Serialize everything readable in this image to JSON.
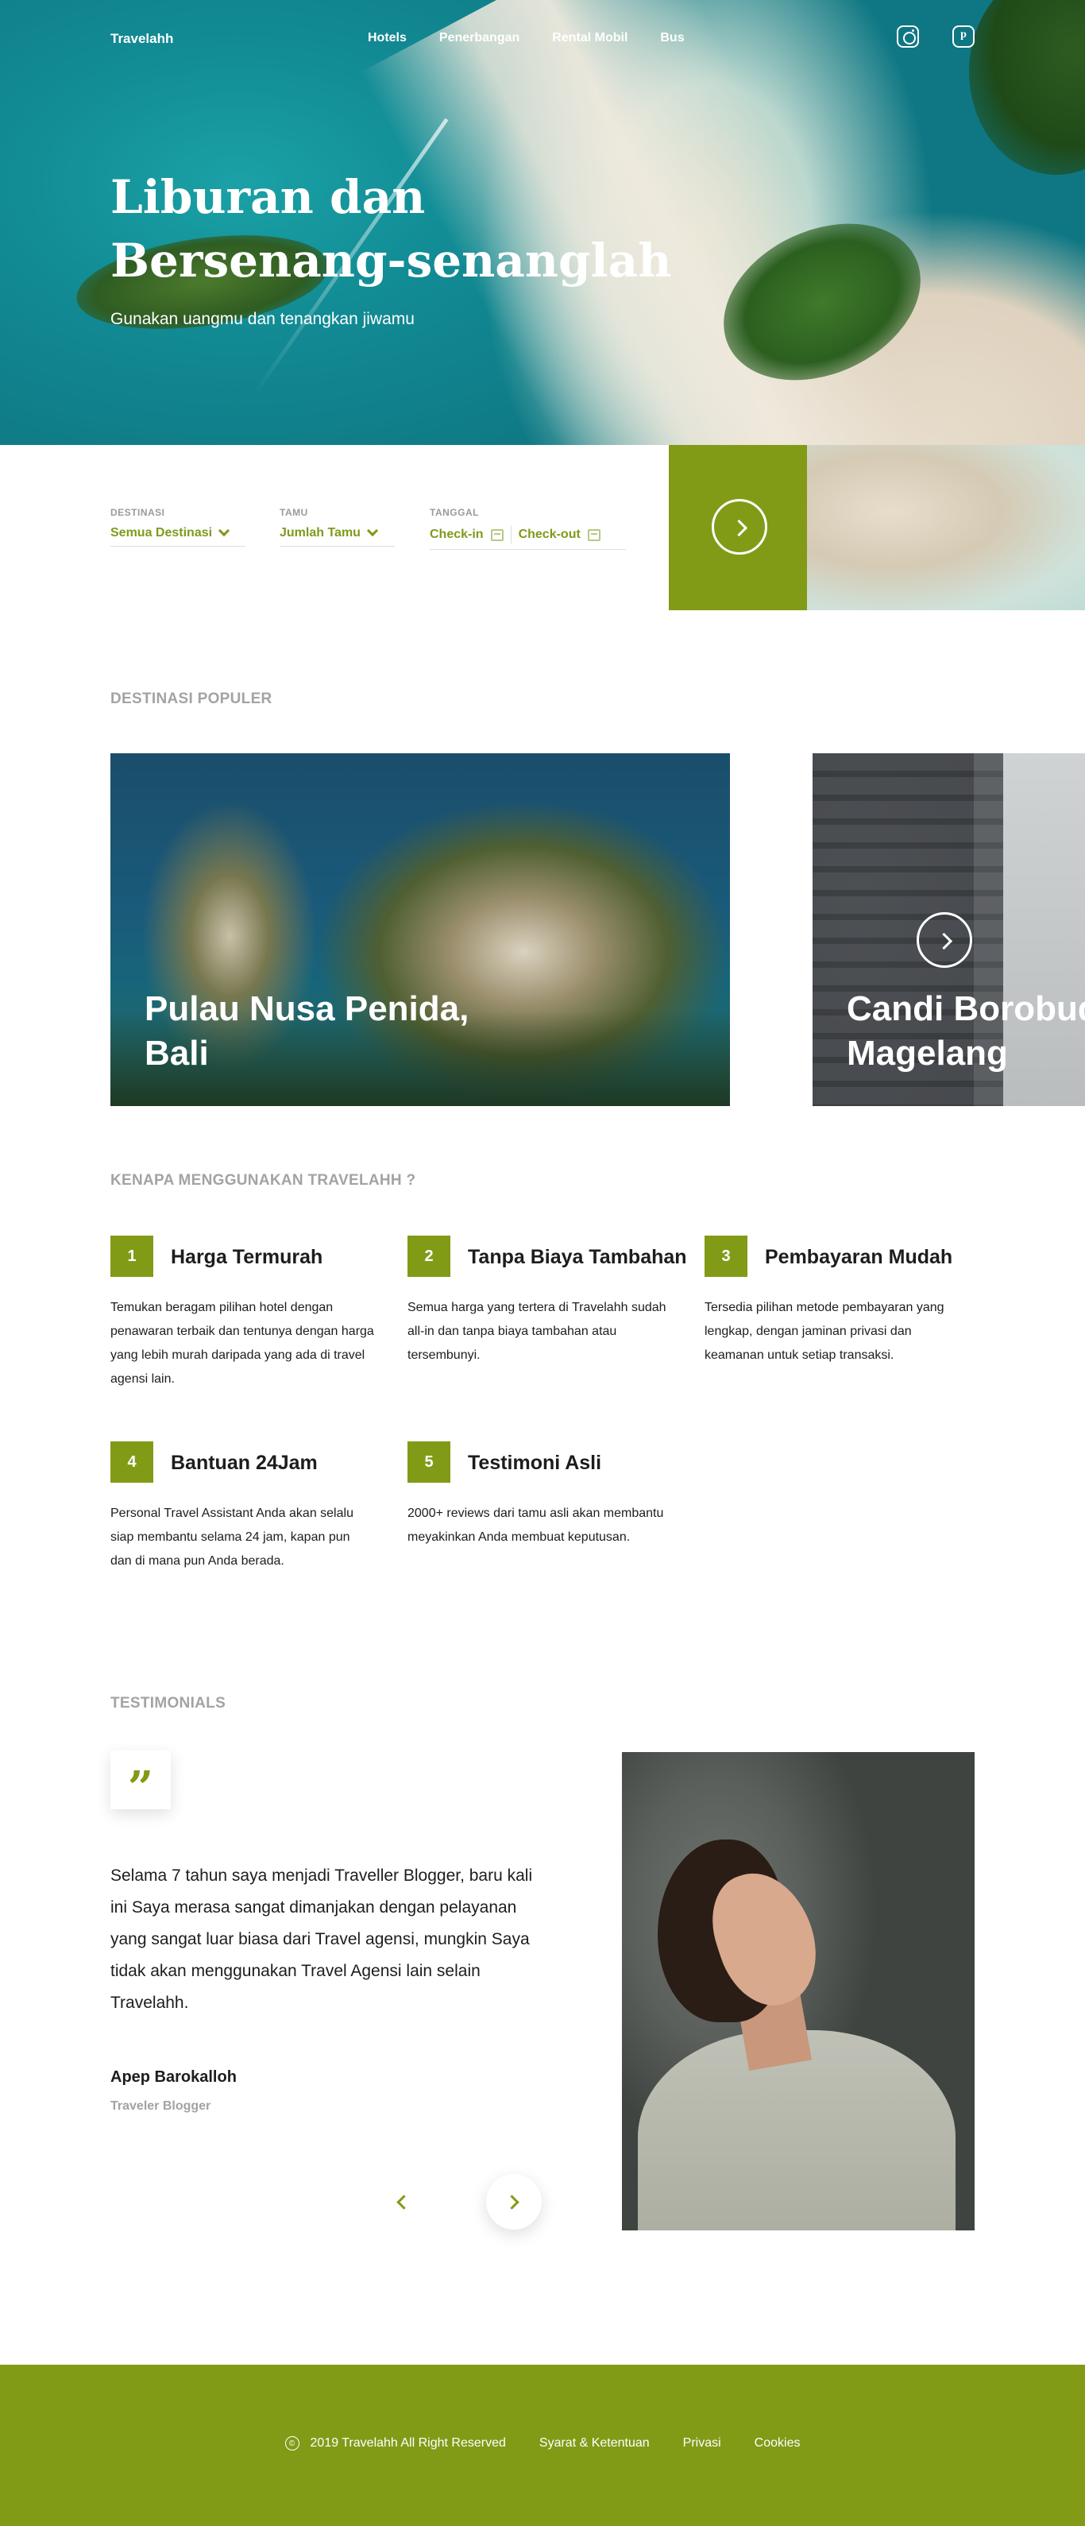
{
  "nav": {
    "brand": "Travelahh",
    "menu": [
      "Hotels",
      "Penerbangan",
      "Rental Mobil",
      "Bus"
    ],
    "social": [
      "instagram-icon",
      "pinterest-icon"
    ]
  },
  "hero": {
    "title": "Liburan dan Bersenang-senanglah",
    "subtitle": "Gunakan uangmu dan tenangkan jiwamu"
  },
  "search": {
    "destinasi_label": "DESTINASI",
    "destinasi_value": "Semua Destinasi",
    "tamu_label": "TAMU",
    "tamu_value": "Jumlah Tamu",
    "tanggal_label": "TANGGAL",
    "checkin": "Check-in",
    "checkout": "Check-out"
  },
  "destinations": {
    "heading": "DESTINASI POPULER",
    "items": [
      {
        "name_line1": "Pulau Nusa Penida,",
        "name_line2": "Bali"
      },
      {
        "name_line1": "Candi Borobudur,",
        "name_line2": "Magelang"
      }
    ]
  },
  "why": {
    "heading": "KENAPA MENGGUNAKAN TRAVELAHH ?",
    "features": [
      {
        "num": "1",
        "title": "Harga Termurah",
        "desc": "Temukan beragam pilihan hotel dengan penawaran terbaik dan tentunya dengan harga yang lebih murah daripada  yang ada di travel agensi lain."
      },
      {
        "num": "2",
        "title": "Tanpa Biaya Tambahan",
        "desc": "Semua harga yang tertera di Travelahh sudah all-in dan tanpa biaya tambahan atau tersembunyi."
      },
      {
        "num": "3",
        "title": "Pembayaran Mudah",
        "desc": "Tersedia pilihan metode pembayaran yang lengkap, dengan jaminan privasi dan keamanan untuk setiap transaksi."
      },
      {
        "num": "4",
        "title": "Bantuan 24Jam",
        "desc": "Personal Travel Assistant Anda akan selalu siap membantu selama 24 jam, kapan pun dan di mana pun Anda berada."
      },
      {
        "num": "5",
        "title": "Testimoni Asli",
        "desc": "2000+ reviews dari tamu asli akan membantu meyakinkan Anda membuat keputusan."
      }
    ]
  },
  "testimonials": {
    "heading": "TESTIMONIALS",
    "quote_mark": "”",
    "text": "Selama 7 tahun saya menjadi Traveller Blogger, baru kali ini Saya merasa sangat dimanjakan dengan pelayanan yang sangat luar biasa dari Travel agensi, mungkin Saya tidak akan menggunakan Travel Agensi lain selain Travelahh.",
    "name": "Apep Barokalloh",
    "role": "Traveler Blogger"
  },
  "footer": {
    "copyright_symbol": "©",
    "copyright": "2019 Travelahh All Right Reserved",
    "links": [
      "Syarat & Ketentuan",
      "Privasi",
      "Cookies"
    ]
  },
  "colors": {
    "accent": "#819b17",
    "heading_gray": "#a3a3a3"
  }
}
